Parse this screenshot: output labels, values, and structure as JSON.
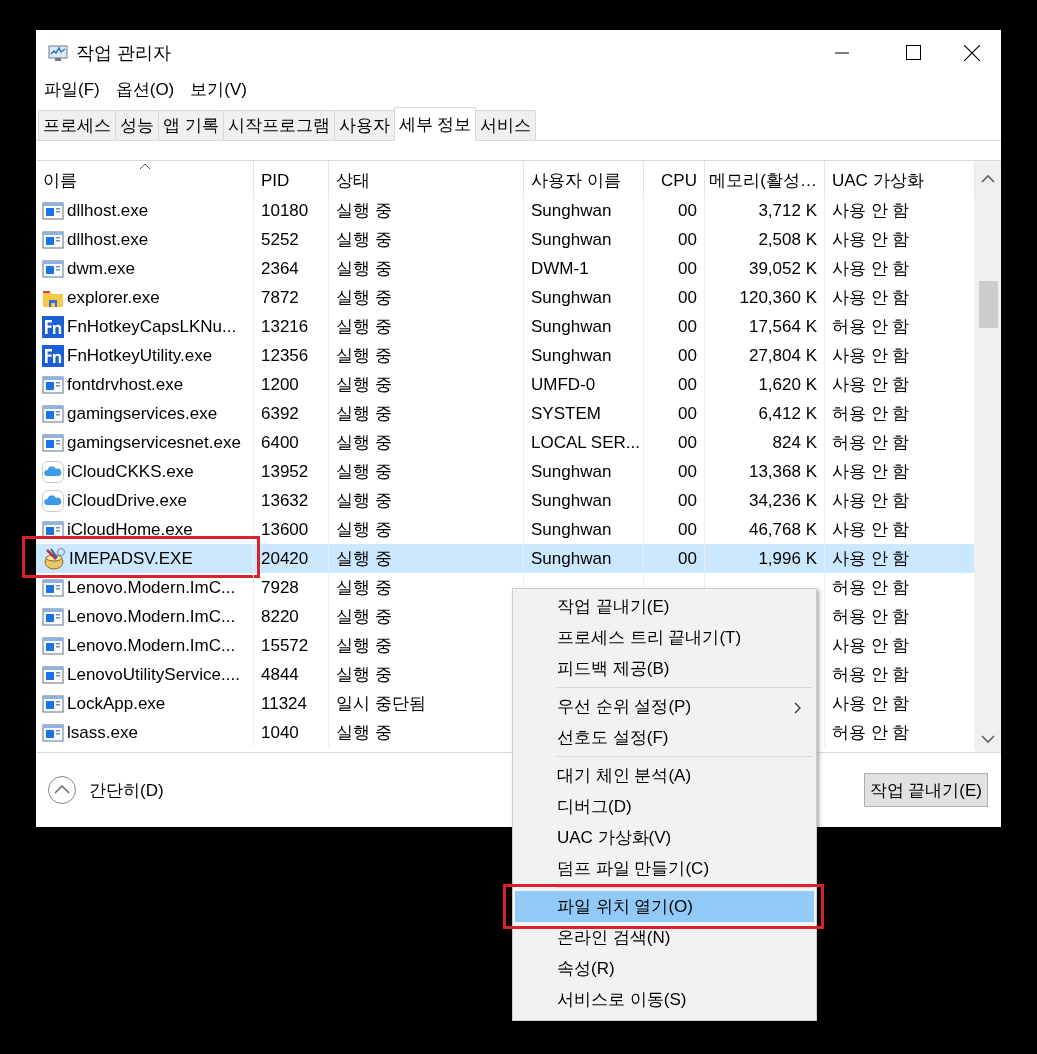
{
  "window": {
    "title": "작업 관리자"
  },
  "menu_bar": [
    "파일(F)",
    "옵션(O)",
    "보기(V)"
  ],
  "tabs": [
    {
      "label": "프로세스",
      "selected": false
    },
    {
      "label": "성능",
      "selected": false
    },
    {
      "label": "앱 기록",
      "selected": false
    },
    {
      "label": "시작프로그램",
      "selected": false
    },
    {
      "label": "사용자",
      "selected": false
    },
    {
      "label": "세부 정보",
      "selected": true
    },
    {
      "label": "서비스",
      "selected": false
    }
  ],
  "table": {
    "columns": [
      {
        "label": "이름",
        "sorted": true
      },
      {
        "label": "PID",
        "sorted": false
      },
      {
        "label": "상태",
        "sorted": false
      },
      {
        "label": "사용자 이름",
        "sorted": false
      },
      {
        "label": "CPU",
        "sorted": false
      },
      {
        "label": "메모리(활성…",
        "sorted": false
      },
      {
        "label": "UAC 가상화",
        "sorted": false
      }
    ],
    "rows": [
      {
        "kind": "app",
        "name": "dllhost.exe",
        "pid": "10180",
        "status": "실행 중",
        "user": "Sunghwan",
        "cpu": "00",
        "memory": "3,712 K",
        "uac": "사용 안 함",
        "selected": false,
        "annotated": false
      },
      {
        "kind": "app",
        "name": "dllhost.exe",
        "pid": "5252",
        "status": "실행 중",
        "user": "Sunghwan",
        "cpu": "00",
        "memory": "2,508 K",
        "uac": "사용 안 함",
        "selected": false,
        "annotated": false
      },
      {
        "kind": "app",
        "name": "dwm.exe",
        "pid": "2364",
        "status": "실행 중",
        "user": "DWM-1",
        "cpu": "00",
        "memory": "39,052 K",
        "uac": "사용 안 함",
        "selected": false,
        "annotated": false
      },
      {
        "kind": "folder",
        "name": "explorer.exe",
        "pid": "7872",
        "status": "실행 중",
        "user": "Sunghwan",
        "cpu": "00",
        "memory": "120,360 K",
        "uac": "사용 안 함",
        "selected": false,
        "annotated": false
      },
      {
        "kind": "fn",
        "name": "FnHotkeyCapsLKNu...",
        "pid": "13216",
        "status": "실행 중",
        "user": "Sunghwan",
        "cpu": "00",
        "memory": "17,564 K",
        "uac": "허용 안 함",
        "selected": false,
        "annotated": false
      },
      {
        "kind": "fn",
        "name": "FnHotkeyUtility.exe",
        "pid": "12356",
        "status": "실행 중",
        "user": "Sunghwan",
        "cpu": "00",
        "memory": "27,804 K",
        "uac": "사용 안 함",
        "selected": false,
        "annotated": false
      },
      {
        "kind": "app",
        "name": "fontdrvhost.exe",
        "pid": "1200",
        "status": "실행 중",
        "user": "UMFD-0",
        "cpu": "00",
        "memory": "1,620 K",
        "uac": "사용 안 함",
        "selected": false,
        "annotated": false
      },
      {
        "kind": "app",
        "name": "gamingservices.exe",
        "pid": "6392",
        "status": "실행 중",
        "user": "SYSTEM",
        "cpu": "00",
        "memory": "6,412 K",
        "uac": "허용 안 함",
        "selected": false,
        "annotated": false
      },
      {
        "kind": "app",
        "name": "gamingservicesnet.exe",
        "pid": "6400",
        "status": "실행 중",
        "user": "LOCAL SER...",
        "cpu": "00",
        "memory": "824 K",
        "uac": "허용 안 함",
        "selected": false,
        "annotated": false
      },
      {
        "kind": "cloud",
        "name": "iCloudCKKS.exe",
        "pid": "13952",
        "status": "실행 중",
        "user": "Sunghwan",
        "cpu": "00",
        "memory": "13,368 K",
        "uac": "사용 안 함",
        "selected": false,
        "annotated": false
      },
      {
        "kind": "cloud",
        "name": "iCloudDrive.exe",
        "pid": "13632",
        "status": "실행 중",
        "user": "Sunghwan",
        "cpu": "00",
        "memory": "34,236 K",
        "uac": "사용 안 함",
        "selected": false,
        "annotated": false
      },
      {
        "kind": "app",
        "name": "iCloudHome.exe",
        "pid": "13600",
        "status": "실행 중",
        "user": "Sunghwan",
        "cpu": "00",
        "memory": "46,768 K",
        "uac": "사용 안 함",
        "selected": false,
        "annotated": false
      },
      {
        "kind": "imepad",
        "name": "IMEPADSV.EXE",
        "pid": "20420",
        "status": "실행 중",
        "user": "Sunghwan",
        "cpu": "00",
        "memory": "1,996 K",
        "uac": "사용 안 함",
        "selected": true,
        "annotated": true
      },
      {
        "kind": "app",
        "name": "Lenovo.Modern.ImC...",
        "pid": "7928",
        "status": "실행 중",
        "uac": "허용 안 함",
        "selected": false,
        "annotated": false
      },
      {
        "kind": "app",
        "name": "Lenovo.Modern.ImC...",
        "pid": "8220",
        "status": "실행 중",
        "uac": "허용 안 함",
        "selected": false,
        "annotated": false
      },
      {
        "kind": "app",
        "name": "Lenovo.Modern.ImC...",
        "pid": "15572",
        "status": "실행 중",
        "uac": "사용 안 함",
        "selected": false,
        "annotated": false
      },
      {
        "kind": "app",
        "name": "LenovoUtilityService....",
        "pid": "4844",
        "status": "실행 중",
        "uac": "허용 안 함",
        "selected": false,
        "annotated": false
      },
      {
        "kind": "app",
        "name": "LockApp.exe",
        "pid": "11324",
        "status": "일시 중단됨",
        "uac": "사용 안 함",
        "selected": false,
        "annotated": false
      },
      {
        "kind": "app",
        "name": "lsass.exe",
        "pid": "1040",
        "status": "실행 중",
        "uac": "허용 안 함",
        "selected": false,
        "annotated": false
      }
    ]
  },
  "footer": {
    "toggle": "간단히(D)",
    "end_button": "작업 끝내기(E)"
  },
  "context_menu": {
    "items": [
      {
        "kind": "item",
        "label": "작업 끝내기(E)",
        "selected": false,
        "submenu": false,
        "annotated": false
      },
      {
        "kind": "item",
        "label": "프로세스 트리 끝내기(T)",
        "selected": false,
        "submenu": false,
        "annotated": false
      },
      {
        "kind": "item",
        "label": "피드백 제공(B)",
        "selected": false,
        "submenu": false,
        "annotated": false
      },
      {
        "kind": "separator"
      },
      {
        "kind": "item",
        "label": "우선 순위 설정(P)",
        "selected": false,
        "submenu": true,
        "annotated": false
      },
      {
        "kind": "item",
        "label": "선호도 설정(F)",
        "selected": false,
        "submenu": false,
        "annotated": false
      },
      {
        "kind": "separator"
      },
      {
        "kind": "item",
        "label": "대기 체인 분석(A)",
        "selected": false,
        "submenu": false,
        "annotated": false
      },
      {
        "kind": "item",
        "label": "디버그(D)",
        "selected": false,
        "submenu": false,
        "annotated": false
      },
      {
        "kind": "item",
        "label": "UAC 가상화(V)",
        "selected": false,
        "submenu": false,
        "annotated": false
      },
      {
        "kind": "item",
        "label": "덤프 파일 만들기(C)",
        "selected": false,
        "submenu": false,
        "annotated": false
      },
      {
        "kind": "separator"
      },
      {
        "kind": "item",
        "label": "파일 위치 열기(O)",
        "selected": true,
        "submenu": false,
        "annotated": true
      },
      {
        "kind": "item",
        "label": "온라인 검색(N)",
        "selected": false,
        "submenu": false,
        "annotated": false
      },
      {
        "kind": "item",
        "label": "속성(R)",
        "selected": false,
        "submenu": false,
        "annotated": false
      },
      {
        "kind": "item",
        "label": "서비스로 이동(S)",
        "selected": false,
        "submenu": false,
        "annotated": false
      }
    ]
  }
}
